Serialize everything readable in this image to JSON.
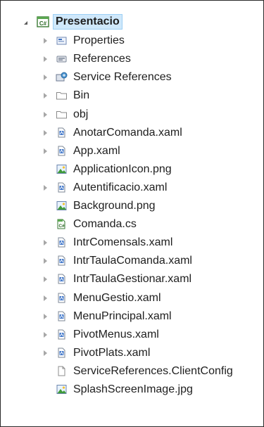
{
  "project": {
    "name": "Presentacio",
    "expanded": true
  },
  "items": [
    {
      "label": "Properties",
      "icon": "properties-icon",
      "expandable": true
    },
    {
      "label": "References",
      "icon": "references-icon",
      "expandable": true
    },
    {
      "label": "Service References",
      "icon": "service-references-icon",
      "expandable": true
    },
    {
      "label": "Bin",
      "icon": "folder-icon",
      "expandable": true
    },
    {
      "label": "obj",
      "icon": "folder-icon",
      "expandable": true
    },
    {
      "label": "AnotarComanda.xaml",
      "icon": "xaml-file-icon",
      "expandable": true
    },
    {
      "label": "App.xaml",
      "icon": "xaml-file-icon",
      "expandable": true
    },
    {
      "label": "ApplicationIcon.png",
      "icon": "image-file-icon",
      "expandable": false
    },
    {
      "label": "Autentificacio.xaml",
      "icon": "xaml-file-icon",
      "expandable": true
    },
    {
      "label": "Background.png",
      "icon": "image-file-icon",
      "expandable": false
    },
    {
      "label": "Comanda.cs",
      "icon": "csharp-file-icon",
      "expandable": false
    },
    {
      "label": "IntrComensals.xaml",
      "icon": "xaml-file-icon",
      "expandable": true
    },
    {
      "label": "IntrTaulaComanda.xaml",
      "icon": "xaml-file-icon",
      "expandable": true
    },
    {
      "label": "IntrTaulaGestionar.xaml",
      "icon": "xaml-file-icon",
      "expandable": true
    },
    {
      "label": "MenuGestio.xaml",
      "icon": "xaml-file-icon",
      "expandable": true
    },
    {
      "label": "MenuPrincipal.xaml",
      "icon": "xaml-file-icon",
      "expandable": true
    },
    {
      "label": "PivotMenus.xaml",
      "icon": "xaml-file-icon",
      "expandable": true
    },
    {
      "label": "PivotPlats.xaml",
      "icon": "xaml-file-icon",
      "expandable": true
    },
    {
      "label": "ServiceReferences.ClientConfig",
      "icon": "config-file-icon",
      "expandable": false
    },
    {
      "label": "SplashScreenImage.jpg",
      "icon": "image-file-icon",
      "expandable": false
    }
  ],
  "colors": {
    "selection_fill": "#cfe8fb",
    "selection_border": "#9ccff4",
    "expander": "#a7a7a7"
  }
}
